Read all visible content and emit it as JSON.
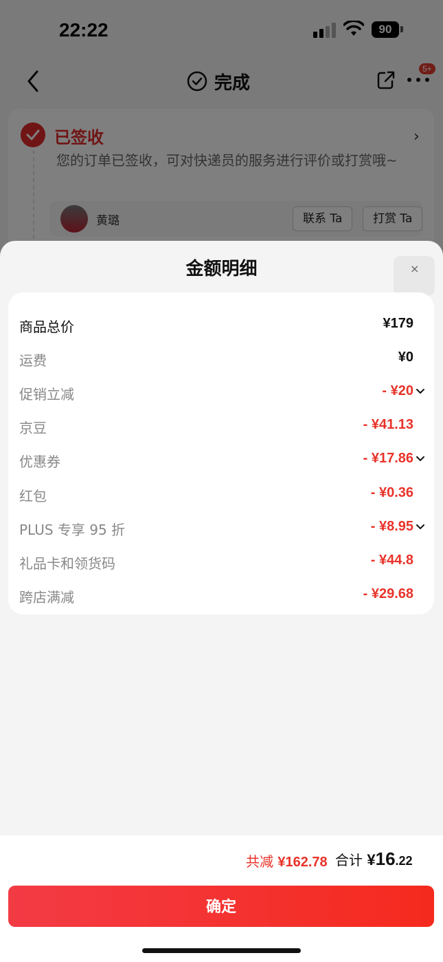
{
  "status_bar": {
    "time": "22:22",
    "battery": "90"
  },
  "nav": {
    "title": "完成",
    "badge": "5+"
  },
  "order": {
    "status_title": "已签收",
    "status_desc": "您的订单已签收，可对快递员的服务进行评价或打赏哦~",
    "courier_name": "黄璐",
    "contact_label": "联系 Ta",
    "tip_label": "打赏 Ta"
  },
  "sheet": {
    "title": "金额明细",
    "rows": [
      {
        "label": "商品总价",
        "value": "¥179",
        "primary": true,
        "red": false,
        "expandable": false
      },
      {
        "label": "运费",
        "value": "¥0",
        "primary": false,
        "red": false,
        "expandable": false
      },
      {
        "label": "促销立减",
        "value": "- ¥20",
        "primary": false,
        "red": true,
        "expandable": true
      },
      {
        "label": "京豆",
        "value": "- ¥41.13",
        "primary": false,
        "red": true,
        "expandable": false
      },
      {
        "label": "优惠券",
        "value": "- ¥17.86",
        "primary": false,
        "red": true,
        "expandable": true
      },
      {
        "label": "红包",
        "value": "- ¥0.36",
        "primary": false,
        "red": true,
        "expandable": false
      },
      {
        "label": "PLUS 专享 95 折",
        "value": "- ¥8.95",
        "primary": false,
        "red": true,
        "expandable": true
      },
      {
        "label": "礼品卡和领货码",
        "value": "- ¥44.8",
        "primary": false,
        "red": true,
        "expandable": false
      },
      {
        "label": "跨店满减",
        "value": "- ¥29.68",
        "primary": false,
        "red": true,
        "expandable": false
      }
    ],
    "summary": {
      "reduce_label": "共减",
      "reduce_value": "¥162.78",
      "total_label": "合计",
      "total_currency": "¥",
      "total_int": "16",
      "total_dec": ".22"
    },
    "confirm_label": "确定"
  },
  "colors": {
    "accent_red": "#e8332a",
    "button_red": "#f33b45"
  },
  "icons": [
    "back-icon",
    "check-circle-icon",
    "share-icon",
    "more-icon",
    "chevron-right-icon",
    "close-icon",
    "chevron-down-icon"
  ]
}
